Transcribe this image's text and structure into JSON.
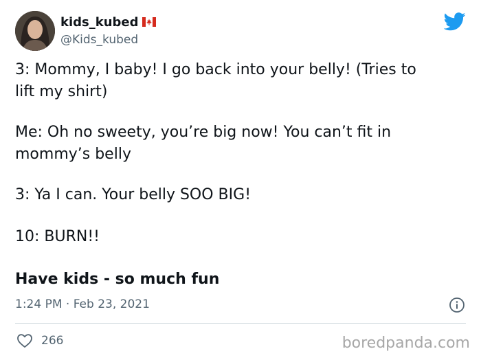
{
  "author": {
    "display_name": "kids_kubed",
    "handle": "@Kids_kubed"
  },
  "tweet": {
    "paragraphs": [
      "3: Mommy, I baby! I go back into your belly! (Tries to\nlift my shirt)",
      "Me: Oh no sweety, you’re big now! You can’t fit in\nmommy’s belly",
      "3: Ya I can. Your belly SOO BIG!",
      "10: BURN!!"
    ],
    "timestamp": "1:24 PM · Feb 23, 2021",
    "like_count": "266"
  },
  "caption": "Have kids - so much fun",
  "watermark": "boredpanda.com",
  "colors": {
    "twitter_blue": "#1d9bf0",
    "secondary_text": "#536471",
    "divider": "#cfd9de",
    "flag_red": "#d52b1e"
  }
}
